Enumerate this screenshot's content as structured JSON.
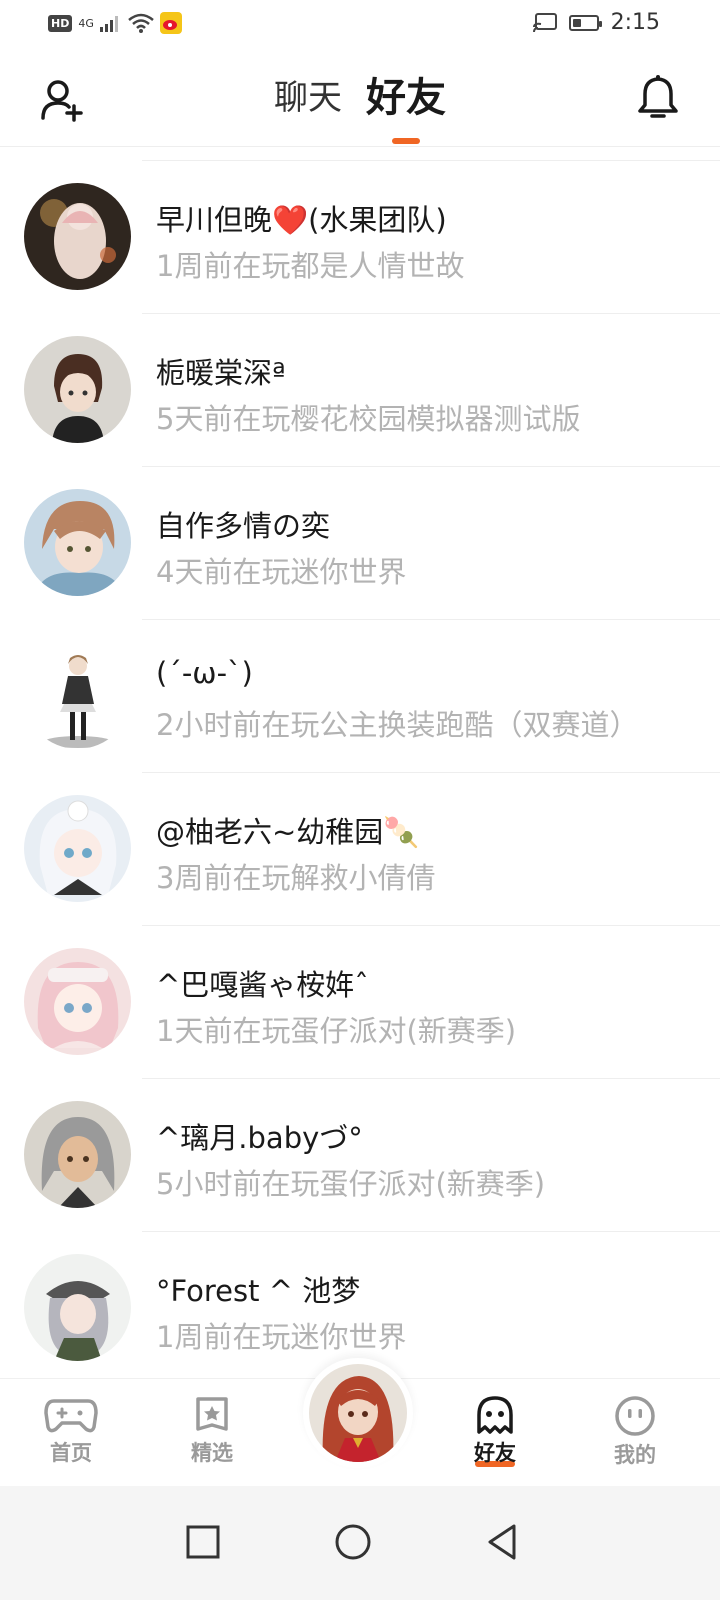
{
  "status_bar": {
    "hd": "HD",
    "network": "4G",
    "time": "2:15",
    "battery_level": 0.35
  },
  "header": {
    "tabs": [
      {
        "label": "聊天",
        "active": false
      },
      {
        "label": "好友",
        "active": true
      }
    ],
    "accent_color": "#f06624"
  },
  "friends": [
    {
      "name": "早川但晚❤️(水果团队)",
      "status": "1周前在玩都是人情世故",
      "avatar_color": "#3a2f28"
    },
    {
      "name": "栀暖棠深ª",
      "status": "5天前在玩樱花校园模拟器测试版",
      "avatar_color": "#d9d6d0"
    },
    {
      "name": "自作多情の奕",
      "status": "4天前在玩迷你世界",
      "avatar_color": "#c9a58a"
    },
    {
      "name": "(´-ω-`)",
      "status": "2小时前在玩公主换装跑酷（双赛道）",
      "avatar_color": "#ffffff"
    },
    {
      "name": "@柚老六~幼稚园🍡",
      "status": "3周前在玩解救小倩倩",
      "avatar_color": "#e8eef4"
    },
    {
      "name": "^巴嘎酱ゃ桉姩ˆ",
      "status": "1天前在玩蛋仔派对(新赛季)",
      "avatar_color": "#f3d7d7"
    },
    {
      "name": "^璃月.babyづ°",
      "status": "5小时前在玩蛋仔派对(新赛季)",
      "avatar_color": "#d8d4cc"
    },
    {
      "name": "°Forest ^ 池梦",
      "status": "1周前在玩迷你世界",
      "avatar_color": "#eef0ee"
    }
  ],
  "bottom_nav": {
    "items": [
      {
        "label": "首页",
        "icon": "gamepad-icon"
      },
      {
        "label": "精选",
        "icon": "star-badge-icon"
      },
      {
        "label": "好友",
        "icon": "ghost-icon",
        "active": true
      },
      {
        "label": "我的",
        "icon": "smiley-icon"
      }
    ]
  }
}
